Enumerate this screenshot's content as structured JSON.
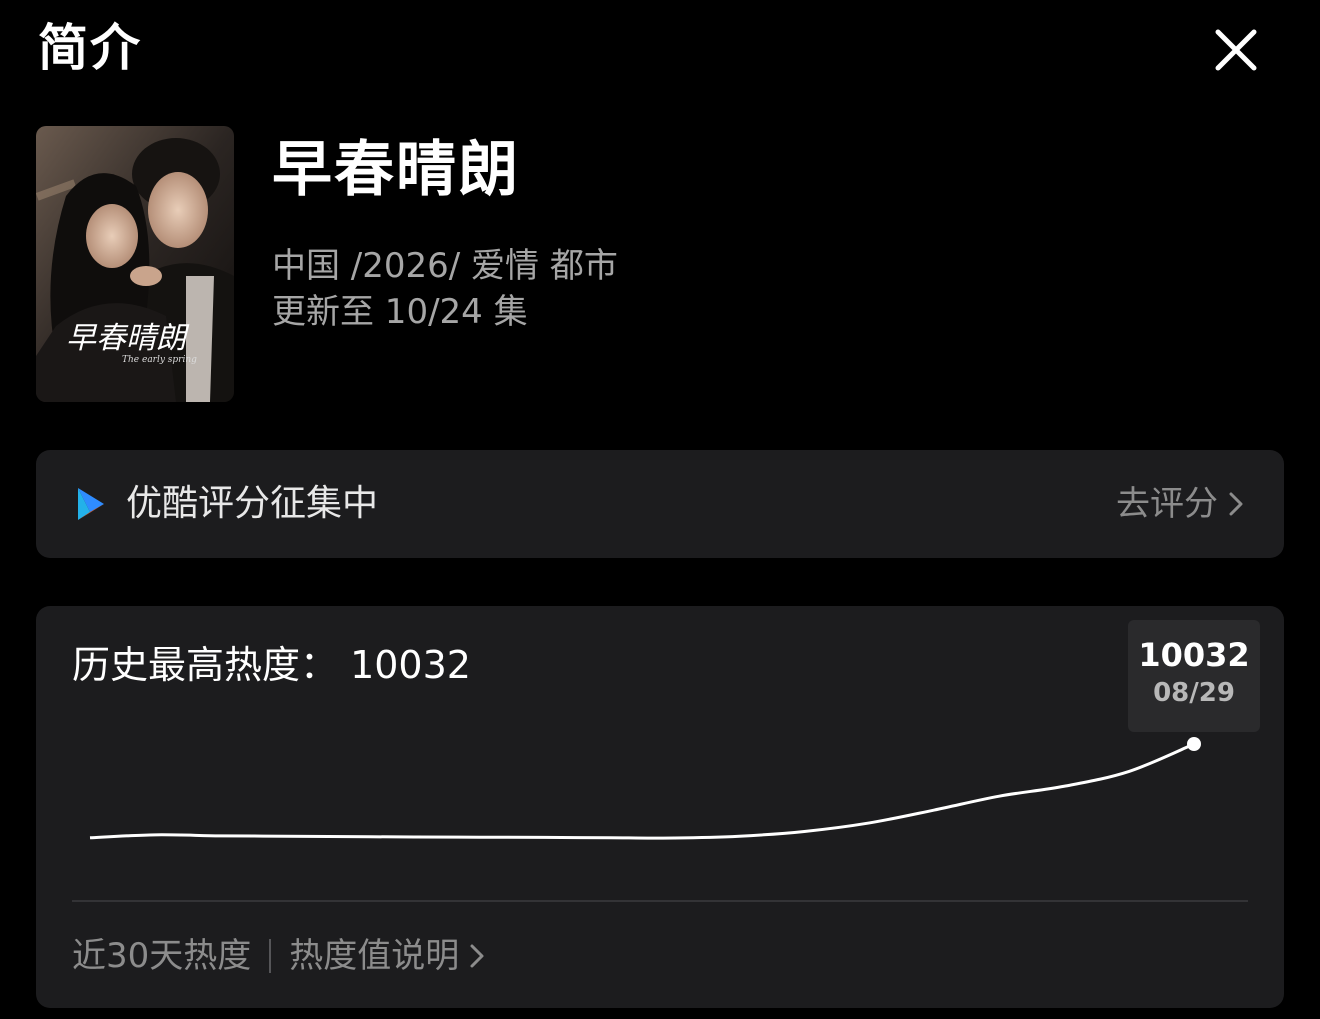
{
  "header": {
    "title": "简介",
    "close_icon": "close-icon"
  },
  "show": {
    "poster_alt": "早春晴朗",
    "poster_calligraphy": "早春晴朗",
    "poster_subtitle": "The early spring",
    "title": "早春晴朗",
    "meta_line1": "中国 /2026/ 爱情  都市",
    "meta_line2": "更新至 10/24 集"
  },
  "rating": {
    "brand_icon": "youku-play-icon",
    "label": "优酷评分征集中",
    "action_label": "去评分",
    "action_icon": "chevron-right-icon",
    "colors": {
      "brand_blue": "#2f8cff",
      "brand_orange": "#ff6a2c"
    }
  },
  "heat": {
    "title": "历史最高热度：  10032",
    "tooltip_value": "10032",
    "tooltip_date": "08/29",
    "footer_left": "近30天热度",
    "footer_link": "热度值说明",
    "link_icon": "chevron-right-icon"
  },
  "chart_data": {
    "type": "line",
    "title": "",
    "series": [
      {
        "values": [
          5300,
          5450,
          5400,
          5380,
          5360,
          5340,
          5330,
          5320,
          5300,
          5290,
          5380,
          5620,
          6050,
          6700,
          7400,
          7900,
          8650,
          10032
        ]
      }
    ],
    "peak": {
      "value": 10032,
      "label": "08/29"
    },
    "ylim": [
      0,
      11000
    ],
    "grid": false,
    "line_color": "#ffffff"
  }
}
